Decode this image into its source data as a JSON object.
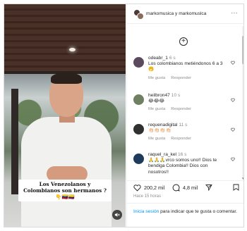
{
  "video": {
    "caption": "Los Venezolanos y Colombianos son hermanos ? 👇🇻🇪🇨🇴"
  },
  "header": {
    "user1": "markomusica",
    "connector": " y ",
    "user2": "markomuslca"
  },
  "comments": [
    {
      "user": "odeabr_1",
      "time": "6 s",
      "text": "Los colombianos metiéndonos 6 a 3 🤭",
      "like": "Me gusta",
      "reply": "Responder",
      "avatar_color": "#5b4a5e"
    },
    {
      "user": "heilbron47",
      "time": "10 s",
      "text": "😂😂😂",
      "like": "Me gusta",
      "reply": "Responder",
      "avatar_color": "#6f7f62"
    },
    {
      "user": "requenadigital",
      "time": "11 s",
      "text": "👏🏻👏🏻👏🏻👏🏻",
      "like": "Me gusta",
      "reply": "Responder",
      "avatar_color": "#303030"
    },
    {
      "user": "raquel_ra_kel",
      "time": "16 s",
      "text": "🙏🙏🙏vrco somos uno!! Dios te bendiga Colombia!! Dios con nosotros!!",
      "like": "",
      "reply": "",
      "avatar_color": "#1f3b5c"
    }
  ],
  "actions": {
    "likes": "200,2 mil",
    "comments": "4,8 mil"
  },
  "timestamp": "Hace 15 horas",
  "login": {
    "link": "Inicia sesión",
    "rest": " para indicar que te gusta o comentar."
  }
}
